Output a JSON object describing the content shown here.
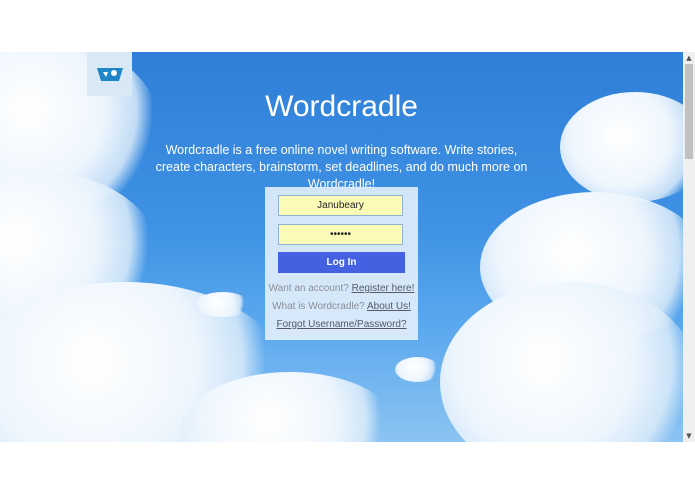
{
  "app": {
    "title": "Wordcradle",
    "tagline": "Wordcradle is a free online novel writing software. Write stories, create characters, brainstorm, set deadlines, and do much more on Wordcradle!"
  },
  "login": {
    "username_value": "Janubeary",
    "password_value": "••••••",
    "login_label": "Log In",
    "register_prompt": "Want an account?",
    "register_link": "Register here!",
    "about_prompt": "What is Wordcradle?",
    "about_link": "About Us!",
    "forgot_link": "Forgot Username/Password?"
  },
  "icons": {
    "logo": "wordcradle-logo-icon",
    "scroll_up": "scroll-up-arrow-icon",
    "scroll_down": "scroll-down-arrow-icon"
  },
  "colors": {
    "sky": "#3f92e4",
    "field_bg": "#fbfbb7",
    "button": "#4361e0"
  }
}
